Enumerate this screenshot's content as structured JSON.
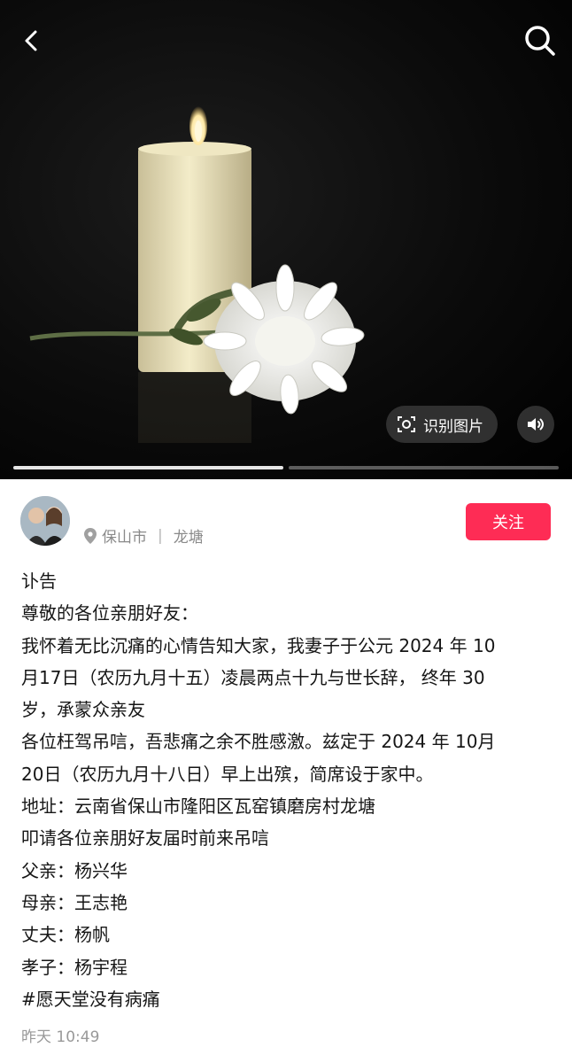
{
  "header": {
    "back_icon": "chevron-left-icon",
    "search_icon": "search-icon"
  },
  "hero": {
    "recognize_label": "识别图片",
    "recognize_icon": "scan-icon",
    "sound_icon": "speaker-icon",
    "progress": {
      "total": 2,
      "active": 1
    }
  },
  "author": {
    "location_city": "保山市",
    "location_area": "龙塘",
    "follow_label": "关注"
  },
  "post": {
    "lines": [
      "讣告",
      "尊敬的各位亲朋好友：",
      "我怀着无比沉痛的心情告知大家，我妻子于公元 2024 年 10",
      "月17日（农历九月十五）凌晨两点十九与世长辞， 终年 30",
      "岁，承蒙众亲友",
      "各位枉驾吊唁，吾悲痛之余不胜感激。兹定于 2024 年 10月",
      "20日（农历九月十八日）早上出殡，简席设于家中。",
      "地址：云南省保山市隆阳区瓦窑镇磨房村龙塘",
      "叩请各位亲朋好友届时前来吊唁",
      "父亲：杨兴华",
      "母亲：王志艳",
      "丈夫：杨帆",
      "孝子：杨宇程",
      "#愿天堂没有病痛"
    ],
    "time": "昨天 10:49"
  },
  "colors": {
    "accent": "#fe2c55",
    "muted": "#8a8a8a"
  }
}
